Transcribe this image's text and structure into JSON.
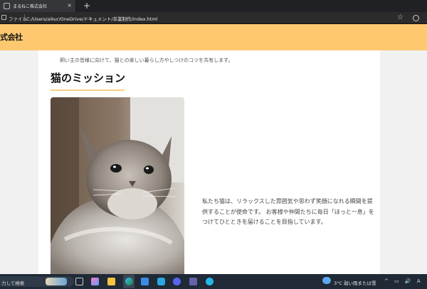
{
  "browser": {
    "tab_title": "まるねこ株式会社",
    "tab_close": "×",
    "new_tab": "+",
    "back": "←",
    "file_label": "ファイル",
    "url": "C:/Users/aikur/OneDrive/ドキュメント/卒業制作/index.html",
    "star": "☆"
  },
  "header": {
    "logo": "式会社",
    "bg_color": "#fec871"
  },
  "main": {
    "intro": "飼い主の皆様に向けて、猫との楽しい暮らし方やしつけのコツを共有します。",
    "mission_title": "猫のミッション",
    "mission_text": "私たち猫は、リラックスした雰囲気や思わず笑顔になれる瞬間を提供することが使命です。 お客様や仲間たちに毎日「ほっと一息」をつけてひとときを届けることを目指しています。",
    "accent_color": "#fcd180"
  },
  "taskbar": {
    "search_text": "力して検索",
    "weather": "3°C 弱い雨または雪",
    "tray": "^ ▭ 🔊 A",
    "icons": [
      "task-view-icon",
      "copilot-icon",
      "file-explorer-icon",
      "edge-icon",
      "store-icon",
      "skype-icon",
      "discord-icon",
      "teams-icon",
      "app-icon"
    ]
  }
}
